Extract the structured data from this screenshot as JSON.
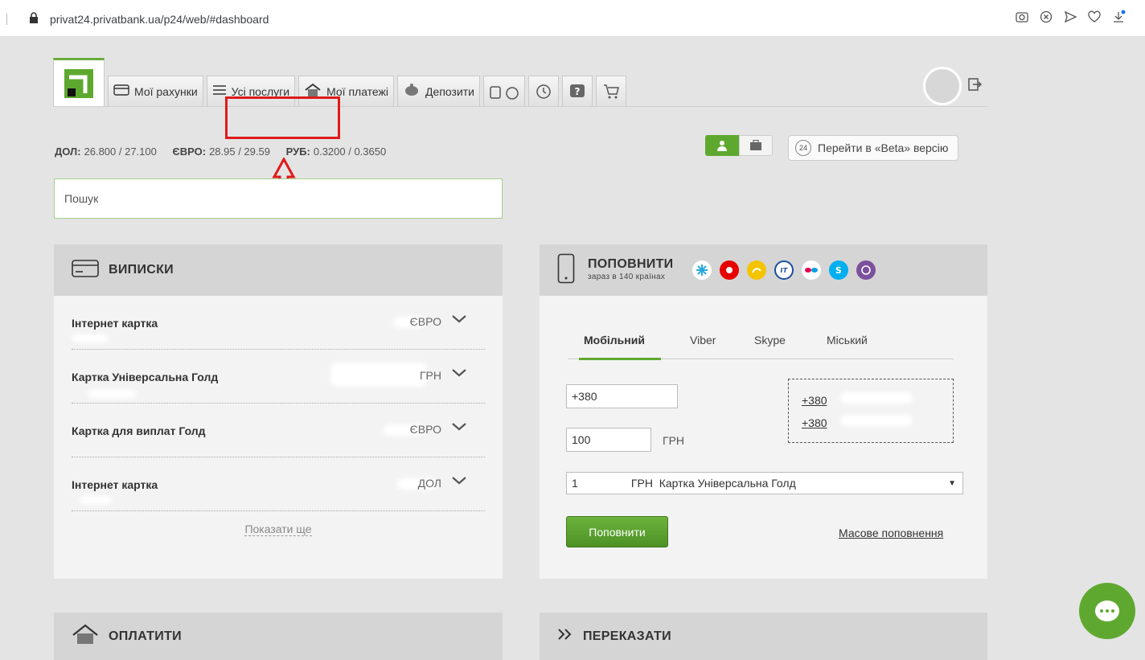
{
  "browser": {
    "url": "privat24.privatbank.ua/p24/web/#dashboard"
  },
  "nav": {
    "accounts": "Мої рахунки",
    "services": "Усі послуги",
    "payments": "Мої платежі",
    "deposits": "Депозити"
  },
  "rates": {
    "usd_label": "ДОЛ:",
    "usd_value": "26.800 / 27.100",
    "eur_label": "ЄВРО:",
    "eur_value": "28.95 / 29.59",
    "rub_label": "РУБ:",
    "rub_value": "0.3200 / 0.3650"
  },
  "beta": {
    "badge": "24",
    "label": "Перейти в «Beta» версію"
  },
  "search": {
    "placeholder": "Пошук"
  },
  "statements": {
    "title": "ВИПИСКИ",
    "accounts": [
      {
        "name": "Інтернет картка",
        "currency": "ЄВРО"
      },
      {
        "name": "Картка Універсальна Голд",
        "currency": "ГРН"
      },
      {
        "name": "Картка для виплат Голд",
        "currency": "ЄВРО"
      },
      {
        "name": "Інтернет картка",
        "currency": "ДОЛ"
      }
    ],
    "show_more": "Показати ще"
  },
  "topup": {
    "title": "ПОПОВНИТИ",
    "subtitle": "зараз в 140 країнах",
    "tabs": [
      "Мобільний",
      "Viber",
      "Skype",
      "Міський"
    ],
    "phone_value": "+380",
    "amount_value": "100",
    "currency": "ГРН",
    "recent": [
      "+380",
      "+380"
    ],
    "card_select": "1                 ГРН  Картка Універсальна Голд",
    "button": "Поповнити",
    "mass_link": "Масове поповнення"
  },
  "pay": {
    "title": "ОПЛАТИТИ"
  },
  "transfer": {
    "title": "ПЕРЕКАЗАТИ"
  },
  "colors": {
    "accent": "#5fa830",
    "highlight": "#e01a1a",
    "panel_head": "#d5d5d5"
  }
}
